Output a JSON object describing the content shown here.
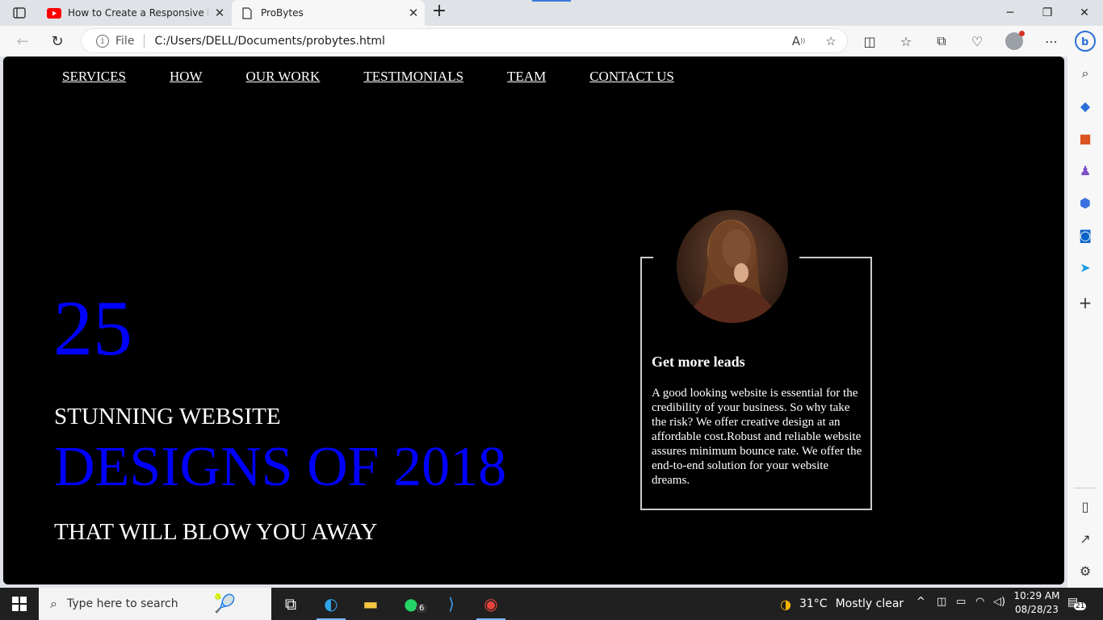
{
  "browser": {
    "tabs": [
      {
        "title": "How to Create a Responsive Pers",
        "favicon": "youtube-icon",
        "active": false
      },
      {
        "title": "ProBytes",
        "favicon": "page-icon",
        "active": true
      }
    ],
    "address": {
      "scheme_label": "File",
      "url": "C:/Users/DELL/Documents/probytes.html"
    }
  },
  "site": {
    "nav": [
      "SERVICES",
      "HOW",
      "OUR WORK",
      "TESTIMONIALS",
      "TEAM",
      "CONTACT US"
    ],
    "hero": {
      "number": "25",
      "line1": "STUNNING WEBSITE",
      "line2": "DESIGNS OF 2018",
      "line3": "THAT WILL BLOW YOU AWAY"
    },
    "card": {
      "title": "Get more leads",
      "text": "A good looking website is essential for the credibility of your business. So why take the risk? We offer creative design at an affordable cost.Robust and reliable website assures minimum bounce rate. We offer the end-to-end solution for your website dreams."
    },
    "colors": {
      "accent": "#0000ff",
      "background": "#000000",
      "text": "#ffffff"
    }
  },
  "taskbar": {
    "search_placeholder": "Type here to search",
    "whatsapp_badge": "6",
    "weather": {
      "temp": "31°C",
      "condition": "Mostly clear"
    },
    "clock": {
      "time": "10:29 AM",
      "date": "08/28/23"
    },
    "notifications": "21"
  }
}
